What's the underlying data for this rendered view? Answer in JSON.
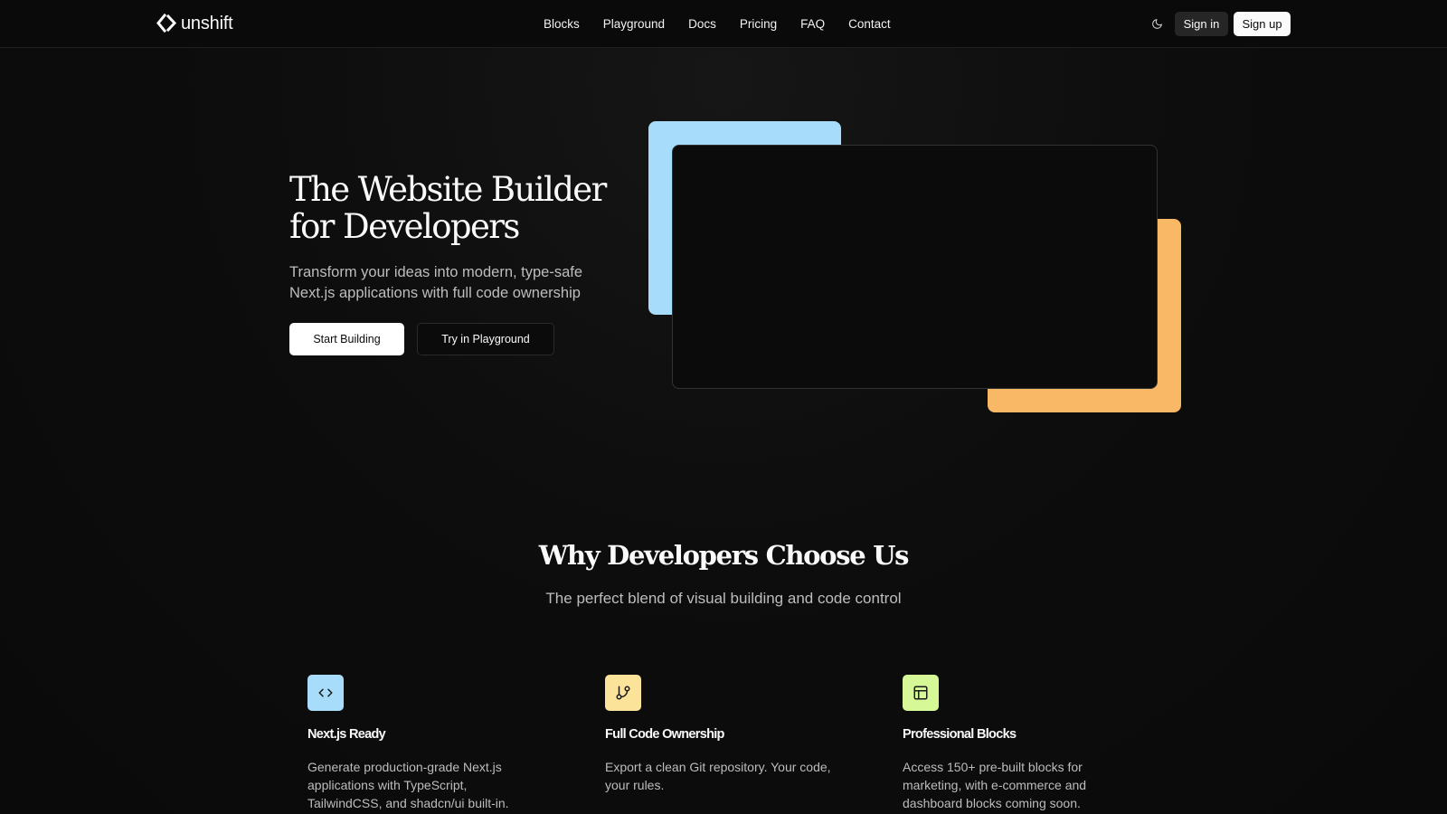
{
  "header": {
    "brand": "unshift",
    "nav": [
      {
        "label": "Blocks"
      },
      {
        "label": "Playground"
      },
      {
        "label": "Docs"
      },
      {
        "label": "Pricing"
      },
      {
        "label": "FAQ"
      },
      {
        "label": "Contact"
      }
    ],
    "theme_toggle_icon": "moon-icon",
    "sign_in": "Sign in",
    "sign_up": "Sign up"
  },
  "hero": {
    "title_line1": "The Website Builder",
    "title_line2": "for Developers",
    "subtitle": "Transform your ideas into modern, type-safe Next.js applications with full code ownership",
    "primary_button": "Start Building",
    "secondary_button": "Try in Playground"
  },
  "features_section": {
    "title": "Why Developers Choose Us",
    "subtitle": "The perfect blend of visual building and code control",
    "items": [
      {
        "icon": "code-icon",
        "icon_bg": "#a8dcfb",
        "title": "Next.js Ready",
        "description": "Generate production-grade Next.js applications with TypeScript, TailwindCSS, and shadcn/ui built-in."
      },
      {
        "icon": "git-branch-icon",
        "icon_bg": "#fbe39a",
        "title": "Full Code Ownership",
        "description": "Export a clean Git repository. Your code, your rules."
      },
      {
        "icon": "layout-icon",
        "icon_bg": "#d7f896",
        "title": "Professional Blocks",
        "description": "Access 150+ pre-built blocks for marketing, with e-commerce and dashboard blocks coming soon."
      }
    ]
  },
  "colors": {
    "background": "#0b0b0b",
    "deco_blue": "#a8dcfb",
    "deco_orange": "#f8b866"
  }
}
